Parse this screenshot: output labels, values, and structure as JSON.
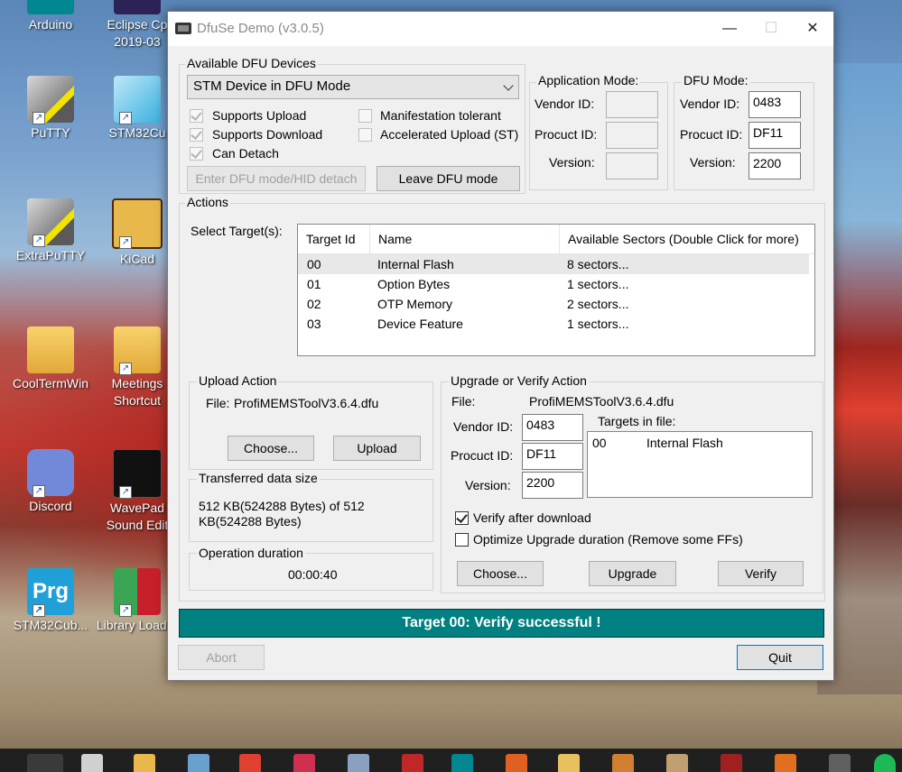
{
  "desktop": {
    "icons": [
      {
        "label": "Arduino"
      },
      {
        "label": "Eclipse Cp 2019-03"
      },
      {
        "label": "PuTTY"
      },
      {
        "label": "STM32Cu"
      },
      {
        "label": "ExtraPuTTY"
      },
      {
        "label": "KiCad"
      },
      {
        "label": "CoolTermWin"
      },
      {
        "label": "Meetings Shortcut"
      },
      {
        "label": "Discord"
      },
      {
        "label": "WavePad Sound Edit"
      },
      {
        "label": "STM32Cub..."
      },
      {
        "label": "Library Loader"
      }
    ],
    "prg_text": "Prg"
  },
  "window": {
    "title": "DfuSe Demo (v3.0.5)",
    "minimize": "—",
    "maximize": "☐",
    "close": "✕"
  },
  "devices": {
    "group_label": "Available DFU Devices",
    "selected": "STM Device in DFU Mode",
    "supports_upload": "Supports Upload",
    "supports_download": "Supports Download",
    "can_detach": "Can Detach",
    "manifestation_tolerant": "Manifestation tolerant",
    "accelerated_upload": "Accelerated Upload (ST)",
    "enter_dfu_btn": "Enter DFU mode/HID detach",
    "leave_dfu_btn": "Leave DFU mode"
  },
  "app_mode": {
    "group_label": "Application Mode:",
    "vendor_label": "Vendor ID:",
    "product_label": "Procuct ID:",
    "version_label": "Version:",
    "vendor_value": "",
    "product_value": "",
    "version_value": ""
  },
  "dfu_mode": {
    "group_label": "DFU Mode:",
    "vendor_label": "Vendor ID:",
    "product_label": "Procuct ID:",
    "version_label": "Version:",
    "vendor_value": "0483",
    "product_value": "DF11",
    "version_value": "2200"
  },
  "actions": {
    "group_label": "Actions",
    "select_target_label": "Select Target(s):",
    "columns": [
      "Target Id",
      "Name",
      "Available Sectors (Double Click for more)"
    ],
    "rows": [
      {
        "id": "00",
        "name": "Internal Flash",
        "sectors": "8 sectors..."
      },
      {
        "id": "01",
        "name": "Option Bytes",
        "sectors": "1 sectors..."
      },
      {
        "id": "02",
        "name": "OTP Memory",
        "sectors": "2 sectors..."
      },
      {
        "id": "03",
        "name": "Device Feature",
        "sectors": "1 sectors..."
      }
    ]
  },
  "upload": {
    "group_label": "Upload Action",
    "file_label": "File:",
    "file_value": "ProfiMEMSToolV3.6.4.dfu",
    "choose_btn": "Choose...",
    "upload_btn": "Upload"
  },
  "transferred": {
    "group_label": "Transferred data size",
    "value": "512 KB(524288 Bytes) of 512 KB(524288 Bytes)"
  },
  "duration": {
    "group_label": "Operation duration",
    "value": "00:00:40"
  },
  "upgrade": {
    "group_label": "Upgrade or Verify Action",
    "file_label": "File:",
    "file_value": "ProfiMEMSToolV3.6.4.dfu",
    "vendor_label": "Vendor ID:",
    "product_label": "Procuct ID:",
    "version_label": "Version:",
    "vendor_value": "0483",
    "product_value": "DF11",
    "version_value": "2200",
    "targets_label": "Targets in file:",
    "target_id": "00",
    "target_name": "Internal Flash",
    "verify_after": "Verify after download",
    "optimize": "Optimize Upgrade duration (Remove some FFs)",
    "choose_btn": "Choose...",
    "upgrade_btn": "Upgrade",
    "verify_btn": "Verify"
  },
  "status": {
    "text": "Target 00: Verify successful !"
  },
  "footer": {
    "abort_btn": "Abort",
    "quit_btn": "Quit"
  }
}
